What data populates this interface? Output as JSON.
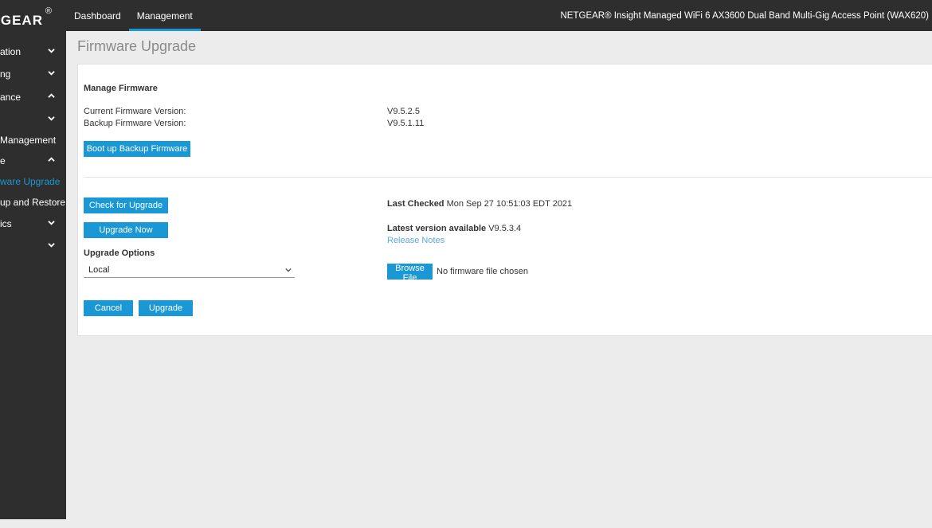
{
  "header": {
    "logo": "GEAR",
    "logo_mark": "®",
    "nav": [
      {
        "label": "Dashboard"
      },
      {
        "label": "Management"
      }
    ],
    "device_title": "NETGEAR® Insight Managed WiFi 6 AX3600 Dual Band Multi-Gig Access Point (WAX620)",
    "accent_color": "#1a98d5"
  },
  "sidebar": {
    "items": [
      {
        "label": "ation",
        "icon": "chevron-down-icon"
      },
      {
        "label": "ng",
        "icon": "chevron-down-icon"
      },
      {
        "label": "ance",
        "icon": "chevron-up-icon"
      },
      {
        "label": "",
        "icon": "chevron-down-icon"
      },
      {
        "label": "Management",
        "icon": ""
      },
      {
        "label": "e",
        "icon": "chevron-up-icon"
      },
      {
        "label": "ware Upgrade",
        "icon": ""
      },
      {
        "label": "up and Restore",
        "icon": ""
      },
      {
        "label": "ics",
        "icon": "chevron-down-icon"
      },
      {
        "label": "",
        "icon": "chevron-down-icon"
      }
    ]
  },
  "page": {
    "title": "Firmware Upgrade",
    "manage_heading": "Manage Firmware",
    "current_label": "Current Firmware Version:",
    "current_value": "V9.5.2.5",
    "backup_label": "Backup Firmware Version:",
    "backup_value": "V9.5.1.11",
    "boot_backup_button": "Boot up Backup Firmware",
    "check_upgrade_button": "Check for Upgrade",
    "upgrade_now_button": "Upgrade Now",
    "last_checked_label": "Last Checked",
    "last_checked_value": "Mon Sep 27 10:51:03 EDT 2021",
    "latest_label": "Latest version available",
    "latest_value": "V9.5.3.4",
    "release_notes_link": "Release Notes",
    "upgrade_options_label": "Upgrade Options",
    "upgrade_options_selected": "Local",
    "browse_button": "Browse File",
    "no_file_text": "No firmware file chosen",
    "cancel_button": "Cancel",
    "upgrade_button": "Upgrade"
  }
}
